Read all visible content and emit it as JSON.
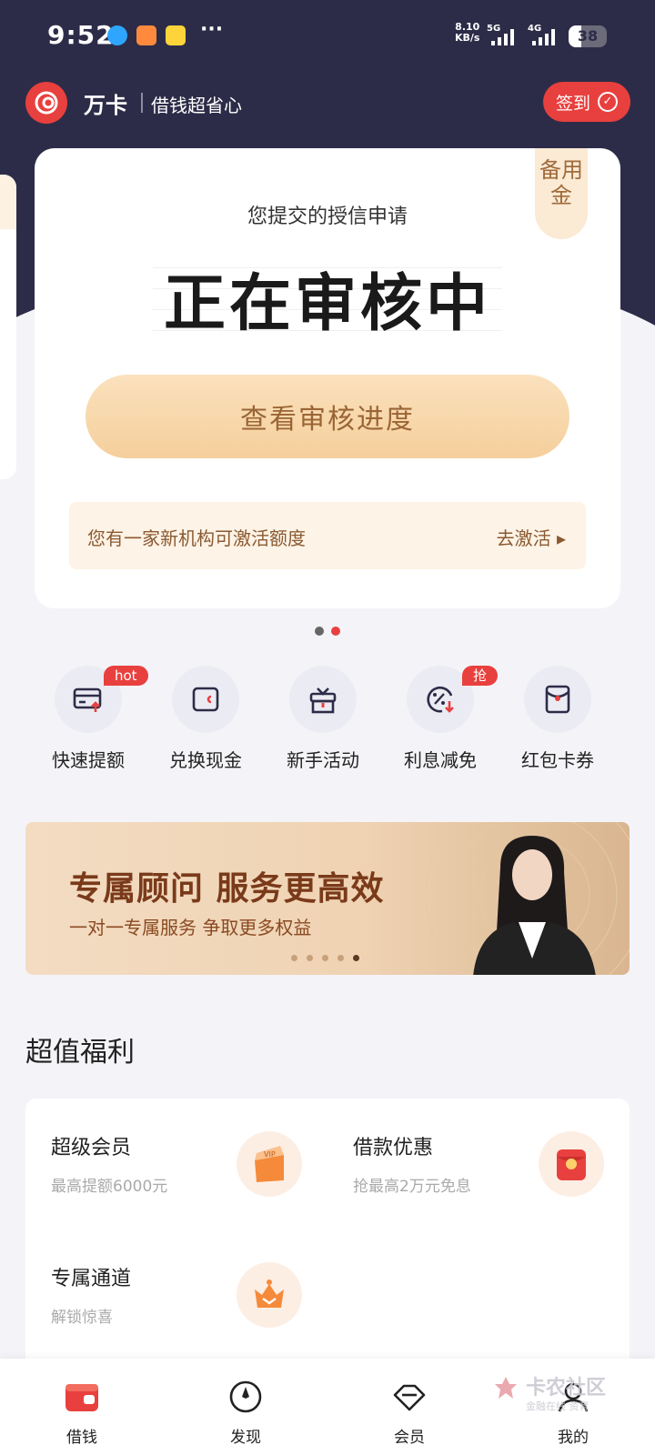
{
  "status_bar": {
    "time": "9:52",
    "net_speed": "8.10",
    "net_unit": "KB/s",
    "sig1": "5G",
    "sig2": "4G",
    "battery": "38"
  },
  "header": {
    "brand": "万卡",
    "slogan": "借钱超省心",
    "checkin_label": "签到"
  },
  "credit_card": {
    "tag": "备用金",
    "subtitle": "您提交的授信申请",
    "status": "正在审核中",
    "progress_button": "查看审核进度",
    "notice_text": "您有一家新机构可激活额度",
    "notice_link": "去激活"
  },
  "quick_actions": [
    {
      "label": "快速提额",
      "badge": "hot",
      "icon": "card-up-icon"
    },
    {
      "label": "兑换现金",
      "badge": "",
      "icon": "wallet-icon"
    },
    {
      "label": "新手活动",
      "badge": "",
      "icon": "gift-icon"
    },
    {
      "label": "利息减免",
      "badge": "抢",
      "icon": "percent-down-icon"
    },
    {
      "label": "红包卡券",
      "badge": "",
      "icon": "red-envelope-icon"
    }
  ],
  "banner": {
    "title": "专属顾问 服务更高效",
    "subtitle": "一对一专属服务 争取更多权益"
  },
  "benefits": {
    "section_title": "超值福利",
    "items": [
      {
        "title": "超级会员",
        "subtitle": "最高提额6000元",
        "icon": "vip-gift-icon"
      },
      {
        "title": "借款优惠",
        "subtitle": "抢最高2万元免息",
        "icon": "red-packet-icon"
      },
      {
        "title": "专属通道",
        "subtitle": "解锁惊喜",
        "icon": "crown-icon"
      }
    ]
  },
  "tabbar": [
    {
      "label": "借钱",
      "icon": "wallet-tab-icon",
      "active": true
    },
    {
      "label": "发现",
      "icon": "compass-icon",
      "active": false
    },
    {
      "label": "会员",
      "icon": "diamond-icon",
      "active": false
    },
    {
      "label": "我的",
      "icon": "user-icon",
      "active": false
    }
  ],
  "watermark": {
    "text": "卡农社区",
    "sub": "金融在线 资育"
  },
  "colors": {
    "header_bg": "#2d2c48",
    "accent_red": "#e8403e",
    "gold_button": "#f5cf9c",
    "gold_text": "#9a6535"
  }
}
